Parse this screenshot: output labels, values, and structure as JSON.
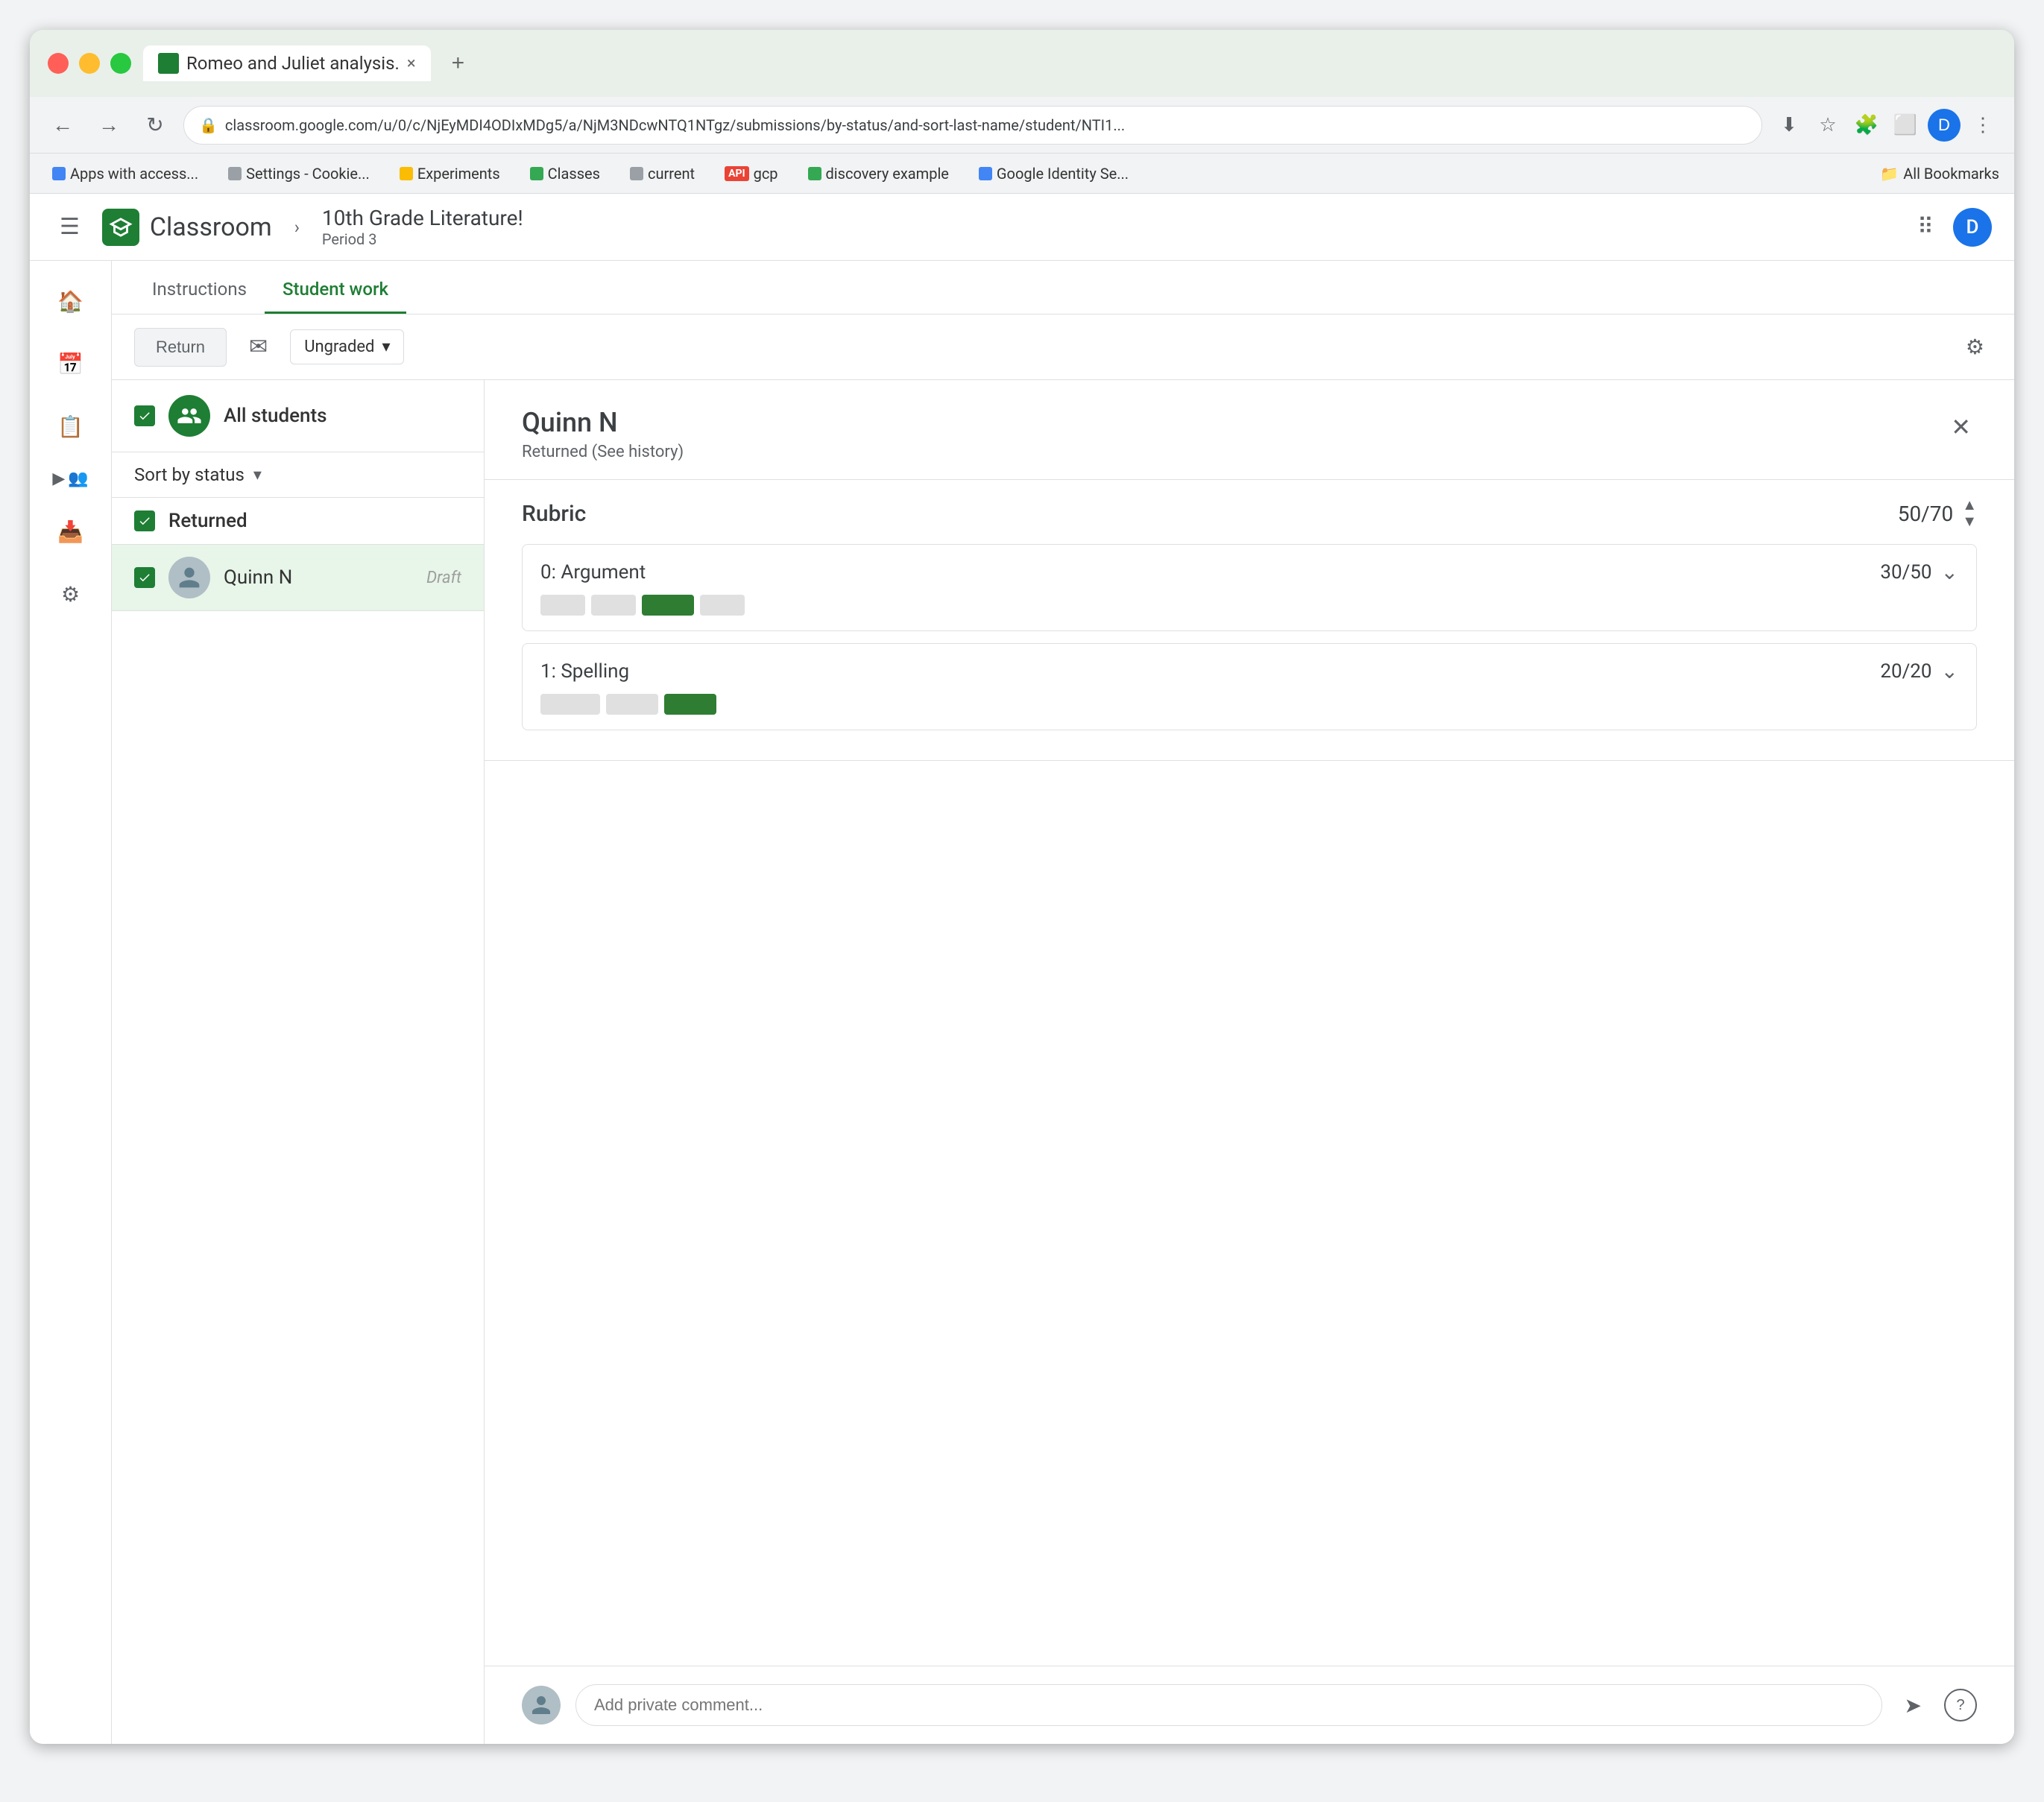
{
  "browser": {
    "tab_title": "Romeo and Juliet analysis.",
    "url": "classroom.google.com/u/0/c/NjEyMDI4ODIxMDg5/a/NjM3NDcwNTQ1NTgz/submissions/by-status/and-sort-last-name/student/NTI1...",
    "bookmarks": [
      {
        "label": "Apps with access...",
        "type": "google"
      },
      {
        "label": "Settings - Cookie...",
        "type": "gear"
      },
      {
        "label": "Experiments",
        "type": "flask"
      },
      {
        "label": "Classes",
        "type": "classes"
      },
      {
        "label": "current",
        "type": "folder"
      },
      {
        "label": "gcp",
        "type": "api"
      },
      {
        "label": "discovery example",
        "type": "discovery"
      },
      {
        "label": "Google Identity Se...",
        "type": "google-id"
      }
    ],
    "all_bookmarks_label": "All Bookmarks"
  },
  "header": {
    "app_name": "Classroom",
    "course_title": "10th Grade Literature!",
    "course_period": "Period 3",
    "avatar_letter": "D"
  },
  "tabs": {
    "items": [
      {
        "label": "Instructions",
        "active": false
      },
      {
        "label": "Student work",
        "active": true
      }
    ]
  },
  "toolbar": {
    "return_label": "Return",
    "grade_label": "Ungraded"
  },
  "student_list": {
    "all_students_label": "All students",
    "sort_label": "Sort by status",
    "returned_label": "Returned",
    "students": [
      {
        "name": "Quinn N",
        "status": "Draft",
        "selected": true
      }
    ]
  },
  "rubric_panel": {
    "student_name": "Quinn N",
    "student_status": "Returned (See history)",
    "rubric_label": "Rubric",
    "total_score": "50/70",
    "criteria": [
      {
        "name": "0: Argument",
        "score": "30/50",
        "bar_segments": [
          {
            "active": false,
            "width": 60
          },
          {
            "active": false,
            "width": 60
          },
          {
            "active": true,
            "width": 70
          },
          {
            "active": false,
            "width": 60
          }
        ]
      },
      {
        "name": "1: Spelling",
        "score": "20/20",
        "bar_segments": [
          {
            "active": false,
            "width": 80
          },
          {
            "active": false,
            "width": 70
          },
          {
            "active": true,
            "width": 70
          }
        ]
      }
    ]
  },
  "comment": {
    "placeholder": "Add private comment..."
  }
}
